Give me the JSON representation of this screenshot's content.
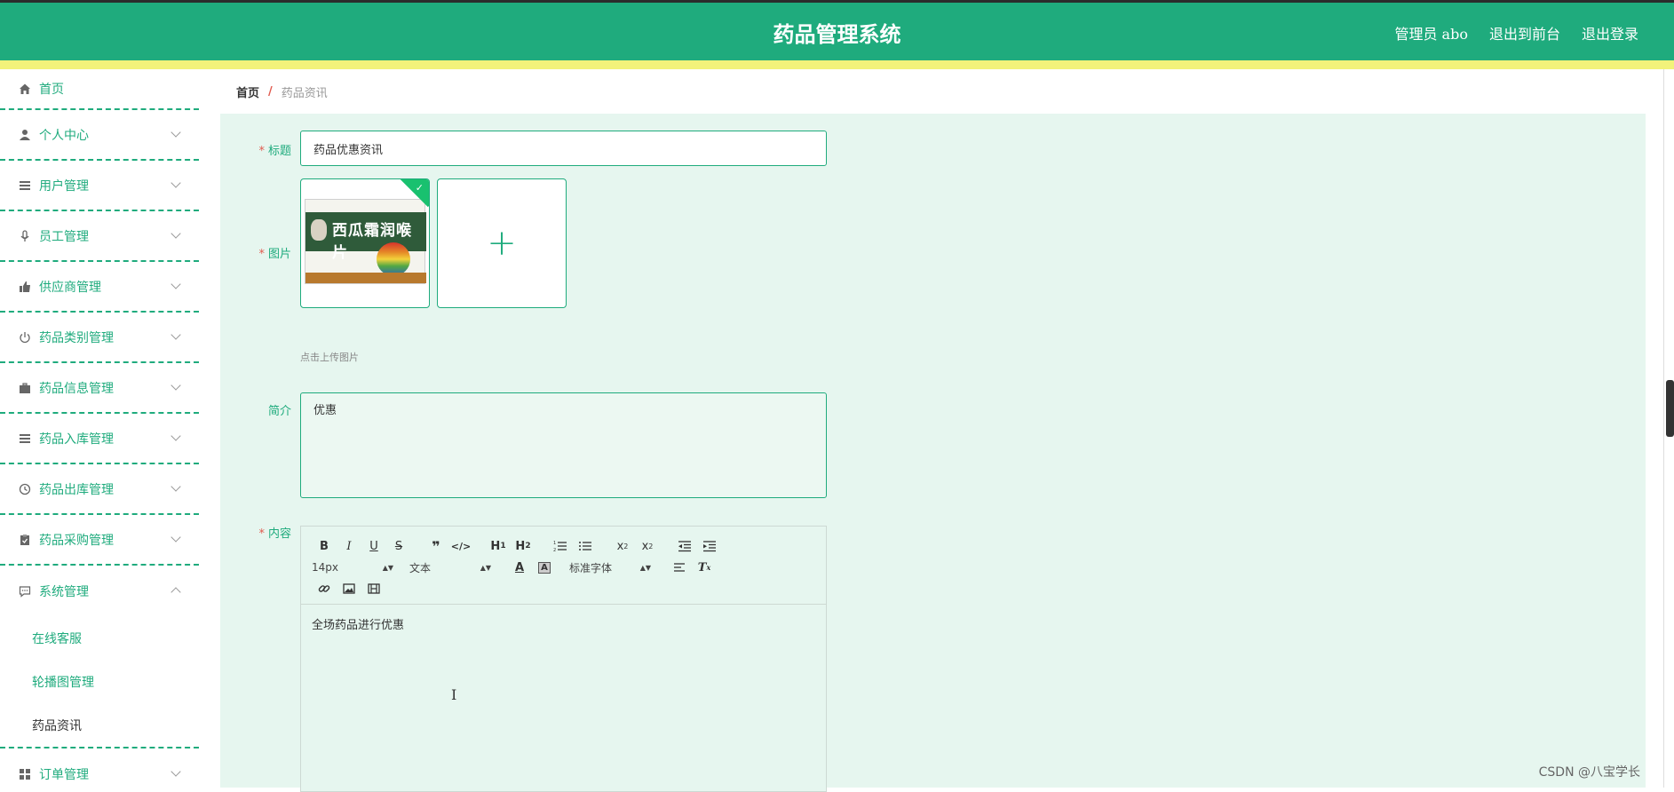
{
  "header": {
    "title": "药品管理系统",
    "links": [
      "管理员 abo",
      "退出到前台",
      "退出登录"
    ]
  },
  "sidebar": {
    "items": [
      {
        "label": "首页",
        "icon": "home-icon"
      },
      {
        "label": "个人中心",
        "icon": "user-icon"
      },
      {
        "label": "用户管理",
        "icon": "list-icon"
      },
      {
        "label": "员工管理",
        "icon": "mic-icon"
      },
      {
        "label": "供应商管理",
        "icon": "thumb-icon"
      },
      {
        "label": "药品类别管理",
        "icon": "power-icon"
      },
      {
        "label": "药品信息管理",
        "icon": "briefcase-icon"
      },
      {
        "label": "药品入库管理",
        "icon": "list-icon"
      },
      {
        "label": "药品出库管理",
        "icon": "clock-icon"
      },
      {
        "label": "药品采购管理",
        "icon": "clipboard-icon"
      },
      {
        "label": "系统管理",
        "icon": "chat-icon"
      },
      {
        "label": "订单管理",
        "icon": "grid-icon"
      }
    ],
    "submenu": [
      "在线客服",
      "轮播图管理",
      "药品资讯"
    ]
  },
  "breadcrumb": {
    "home": "首页",
    "separator": "/",
    "current": "药品资讯"
  },
  "form": {
    "title_label": "标题",
    "title_value": "药品优惠资讯",
    "image_label": "图片",
    "image_text": "西瓜霜润喉片",
    "upload_hint": "点击上传图片",
    "intro_label": "简介",
    "intro_value": "优惠",
    "content_label": "内容",
    "content_value": "全场药品进行优惠"
  },
  "editor": {
    "size_select": "14px",
    "format_select": "文本",
    "font_select": "标准字体"
  },
  "watermark": "CSDN @八宝学长",
  "colors": {
    "accent": "#1fab7d",
    "header_bg": "#1fab7d",
    "yellow_bar": "#f2f27a",
    "required": "#e15a4e",
    "main_bg": "#e6f6ef"
  }
}
